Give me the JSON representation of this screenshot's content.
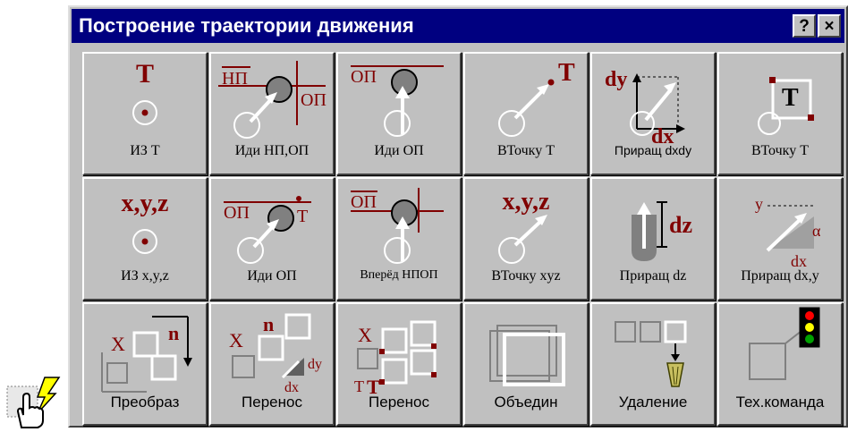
{
  "window": {
    "title": "Построение траектории движения",
    "help_label": "?",
    "close_label": "×"
  },
  "colors": {
    "titlebar": "#000080",
    "accent_red": "#800000",
    "face": "#c0c0c0",
    "highlight": "#ffffff",
    "shadow": "#404040"
  },
  "buttons": {
    "r1": [
      {
        "label": "ИЗ Т",
        "glyph": "Т"
      },
      {
        "label": "Иди НП,ОП",
        "glyph_a": "НП",
        "glyph_b": "ОП"
      },
      {
        "label": "Иди ОП",
        "glyph": "ОП"
      },
      {
        "label": "ВТочку Т",
        "glyph": "Т"
      },
      {
        "label": "Приращ dxdy",
        "glyph_a": "dy",
        "glyph_b": "dx"
      },
      {
        "label": "ВТочку Т",
        "glyph": "Т"
      }
    ],
    "r2": [
      {
        "label": "ИЗ  x,y,z",
        "glyph": "x,y,z"
      },
      {
        "label": "Иди ОП",
        "glyph_a": "ОП",
        "glyph_b": "Т"
      },
      {
        "label": "Вперёд НПОП",
        "glyph": "ОП"
      },
      {
        "label": "ВТочку  xyz",
        "glyph": "x,y,z"
      },
      {
        "label": "Приращ  dz",
        "glyph": "dz"
      },
      {
        "label": "Приращ dx,y",
        "glyph_a": "y",
        "glyph_b": "α",
        "glyph_c": "dx"
      }
    ],
    "r3": [
      {
        "label": "Преобраз",
        "glyph_a": "X",
        "glyph_b": "n"
      },
      {
        "label": "Перенос",
        "glyph_a": "X",
        "glyph_b": "n",
        "glyph_c": "dy",
        "glyph_d": "dx"
      },
      {
        "label": "Перенос",
        "glyph_a": "X",
        "glyph_b": "Т",
        "glyph_c": "Т"
      },
      {
        "label": "Объедин"
      },
      {
        "label": "Удаление"
      },
      {
        "label": "Тех.команда"
      }
    ]
  }
}
